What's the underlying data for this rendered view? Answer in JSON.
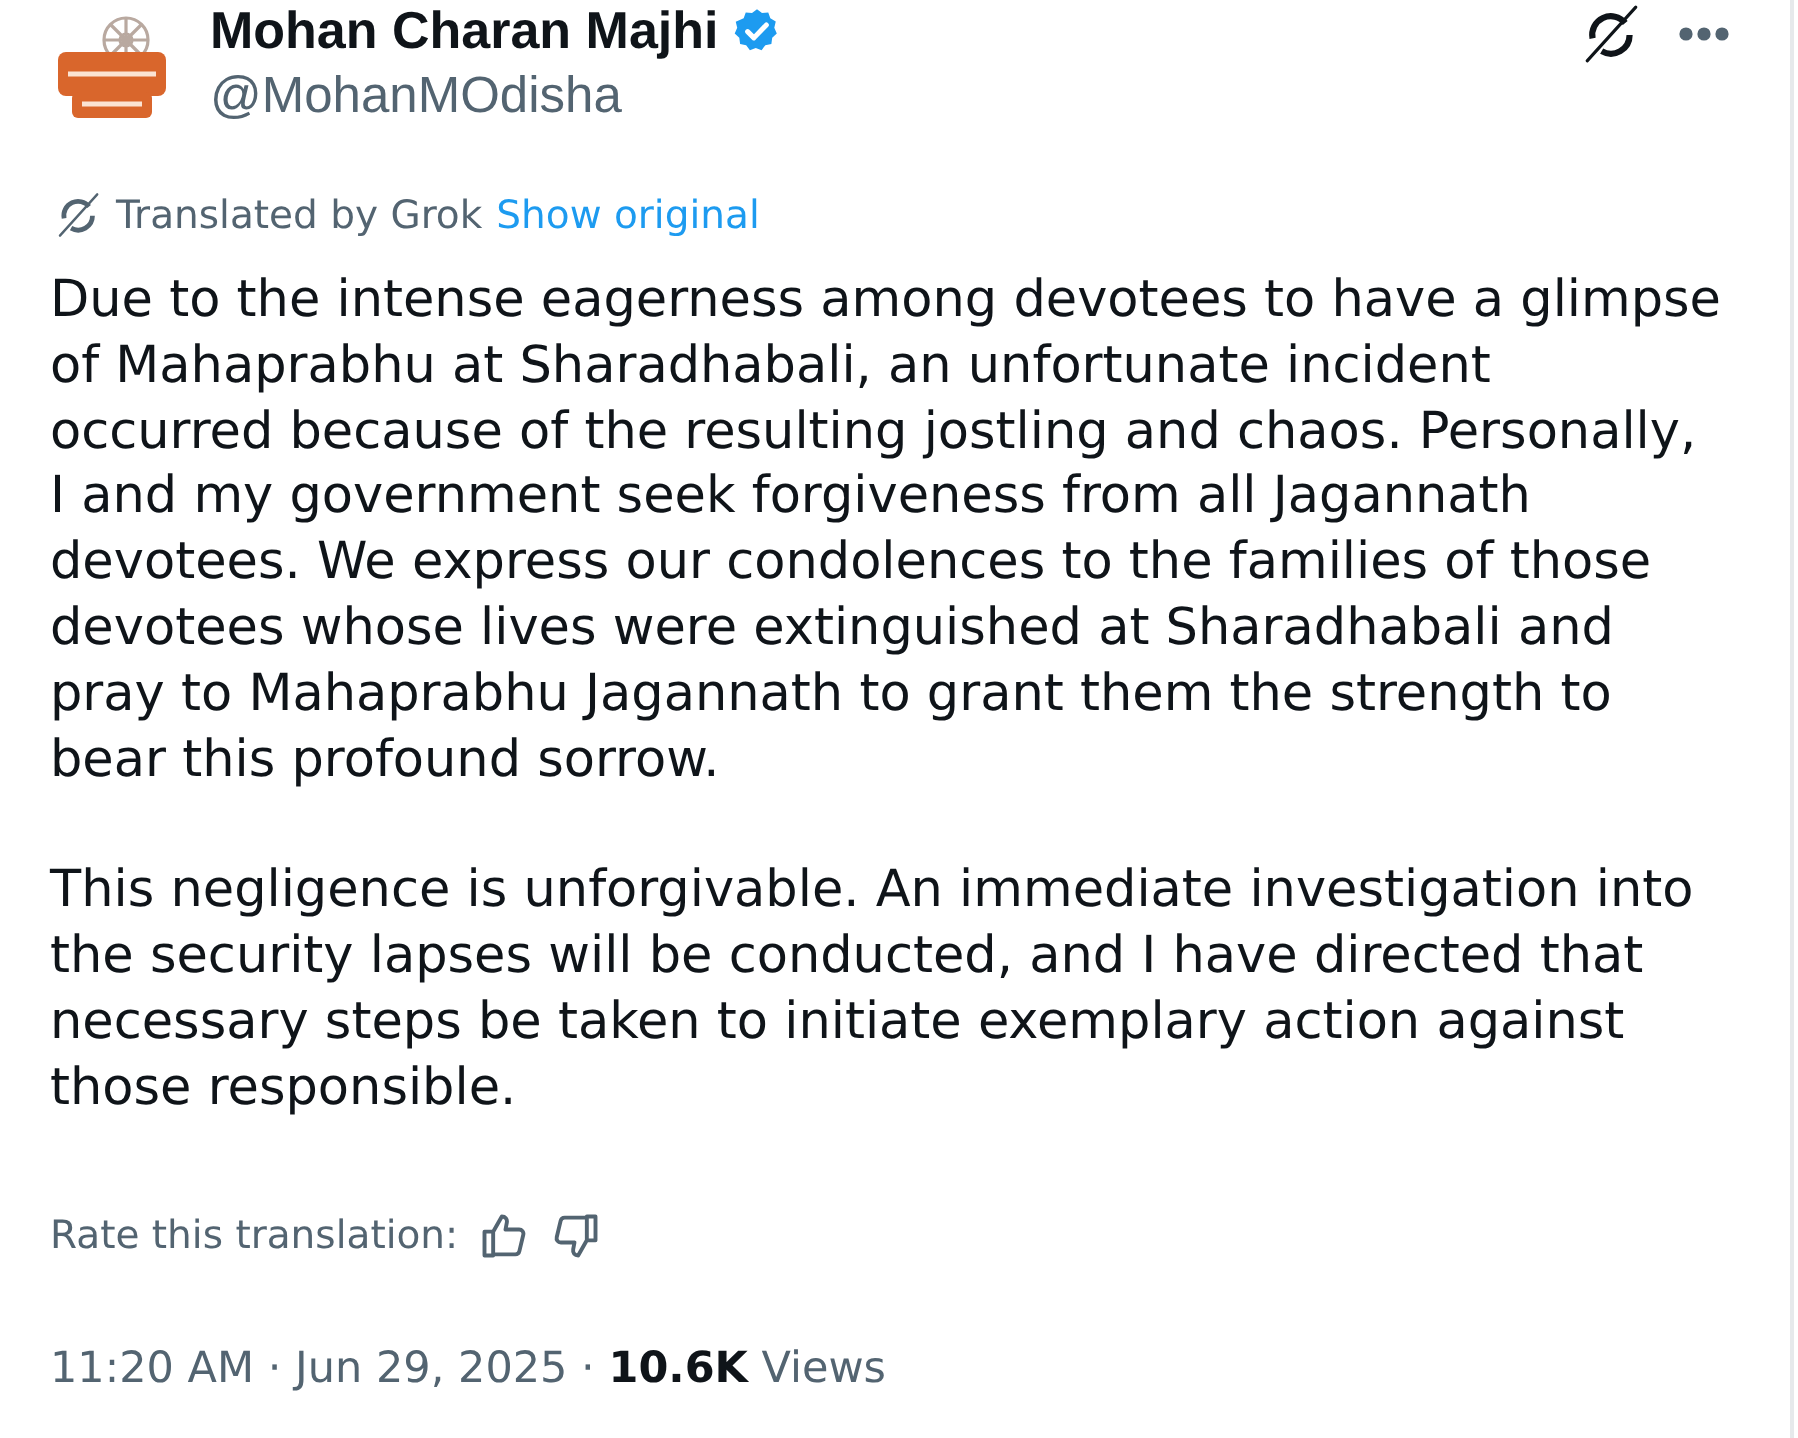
{
  "author": {
    "name": "Mohan Charan Majhi",
    "verified": true,
    "handle": "@MohanMOdisha"
  },
  "translation": {
    "label": "Translated by Grok",
    "link": "Show original"
  },
  "body": [
    "Due to the intense eagerness among devotees to have a glimpse of Mahaprabhu at Sharadhabali, an unfortunate incident occurred because of the resulting jostling and chaos. Personally, I and my government seek forgiveness from all Jagannath devotees. We express our condolences to the families of those devotees whose lives were extinguished at Sharadhabali and pray to Mahaprabhu Jagannath to grant them the strength to bear this profound sorrow.",
    "This negligence is unforgivable. An immediate investigation into the security lapses will be conducted, and I have directed that necessary steps be taken to initiate exemplary action against those responsible."
  ],
  "rating": {
    "label": "Rate this translation:"
  },
  "meta": {
    "line": "11:20 AM · Jun 29, 2025 · **10.6K** Views"
  }
}
